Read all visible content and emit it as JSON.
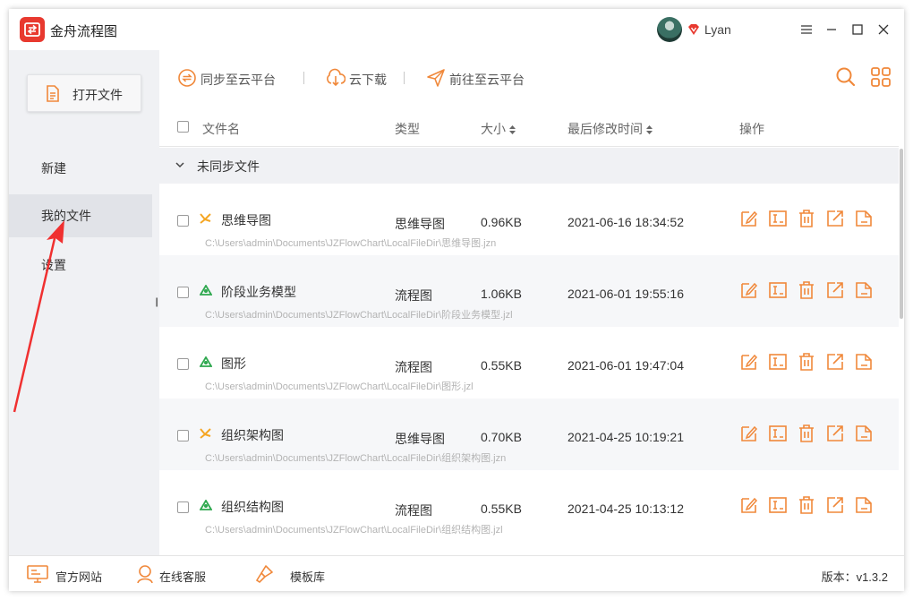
{
  "app": {
    "title": "金舟流程图",
    "username": "Lyan",
    "accent_color": "#f0883a",
    "brand_color": "#e8392f"
  },
  "window_controls": [
    "menu-icon",
    "minimize-icon",
    "maximize-icon",
    "close-icon"
  ],
  "sidebar": {
    "open_button": "打开文件",
    "items": [
      {
        "label": "新建",
        "active": false
      },
      {
        "label": "我的文件",
        "active": true
      },
      {
        "label": "设置",
        "active": false
      }
    ]
  },
  "toolbar": {
    "sync_label": "同步至云平台",
    "download_label": "云下载",
    "goto_label": "前往至云平台"
  },
  "table": {
    "columns": {
      "name": "文件名",
      "type": "类型",
      "size": "大小",
      "modified": "最后修改时间",
      "actions": "操作"
    },
    "group_label": "未同步文件",
    "rows": [
      {
        "name": "思维导图",
        "kind": "mindmap",
        "type": "思维导图",
        "size": "0.96KB",
        "modified": "2021-06-16 18:34:52",
        "path": "C:\\Users\\admin\\Documents\\JZFlowChart\\LocalFileDir\\思维导图.jzn"
      },
      {
        "name": "阶段业务模型",
        "kind": "flow",
        "type": "流程图",
        "size": "1.06KB",
        "modified": "2021-06-01 19:55:16",
        "path": "C:\\Users\\admin\\Documents\\JZFlowChart\\LocalFileDir\\阶段业务模型.jzl"
      },
      {
        "name": "图形",
        "kind": "flow",
        "type": "流程图",
        "size": "0.55KB",
        "modified": "2021-06-01 19:47:04",
        "path": "C:\\Users\\admin\\Documents\\JZFlowChart\\LocalFileDir\\图形.jzl"
      },
      {
        "name": "组织架构图",
        "kind": "mindmap",
        "type": "思维导图",
        "size": "0.70KB",
        "modified": "2021-04-25 10:19:21",
        "path": "C:\\Users\\admin\\Documents\\JZFlowChart\\LocalFileDir\\组织架构图.jzn"
      },
      {
        "name": "组织结构图",
        "kind": "flow",
        "type": "流程图",
        "size": "0.55KB",
        "modified": "2021-04-25 10:13:12",
        "path": "C:\\Users\\admin\\Documents\\JZFlowChart\\LocalFileDir\\组织结构图.jzl"
      }
    ],
    "row_actions": [
      "edit-icon",
      "rename-icon",
      "delete-icon",
      "export-icon",
      "save-as-icon"
    ]
  },
  "footer": {
    "website_label": "官方网站",
    "support_label": "在线客服",
    "templates_label": "模板库",
    "version_text": "版本：v1.3.2"
  }
}
